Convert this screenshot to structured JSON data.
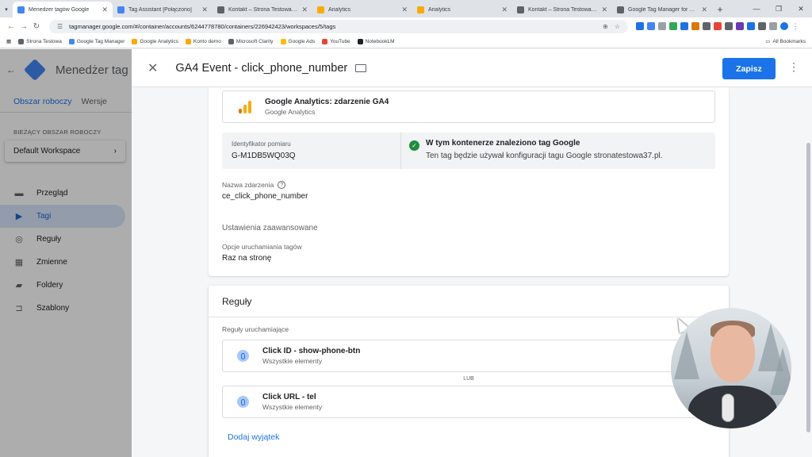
{
  "browser": {
    "tabs": [
      {
        "title": "Menedżer tagów Google",
        "active": true,
        "favicon_color": "#4285f4"
      },
      {
        "title": "Tag Assistant [Połączono]",
        "active": false,
        "favicon_color": "#4285f4"
      },
      {
        "title": "Kontakt – Strona Testowa 37",
        "active": false,
        "favicon_color": "#5f6368"
      },
      {
        "title": "Analytics",
        "active": false,
        "favicon_color": "#f9ab00"
      },
      {
        "title": "Analytics",
        "active": false,
        "favicon_color": "#f9ab00"
      },
      {
        "title": "Kontakt – Strona Testowa 37",
        "active": false,
        "favicon_color": "#5f6368"
      },
      {
        "title": "Google Tag Manager for WordP",
        "active": false,
        "favicon_color": "#5f6368"
      }
    ],
    "url": "tagmanager.google.com/#/container/accounts/6244778780/containers/226942423/workspaces/5/tags",
    "bookmarks": [
      {
        "label": "Strona Testowa",
        "color": "#5f6368"
      },
      {
        "label": "Google Tag Manager",
        "color": "#4285f4"
      },
      {
        "label": "Google Analytics",
        "color": "#f9ab00"
      },
      {
        "label": "Konto demo",
        "color": "#f9ab00"
      },
      {
        "label": "Microsoft Clarity",
        "color": "#5f6368"
      },
      {
        "label": "Google Ads",
        "color": "#fbbc04"
      },
      {
        "label": "YouTube",
        "color": "#ea4335"
      },
      {
        "label": "NotebookLM",
        "color": "#202124"
      }
    ],
    "all_bookmarks": "All Bookmarks"
  },
  "gtm": {
    "app_name": "Menedżer tag",
    "tabs": [
      "Obszar roboczy",
      "Wersje"
    ],
    "workspace_label": "BIEŻĄCY OBSZAR ROBOCZY",
    "workspace_name": "Default Workspace",
    "nav": [
      {
        "label": "Przegląd",
        "icon": "overview-icon",
        "glyph": "▬",
        "active": false
      },
      {
        "label": "Tagi",
        "icon": "tag-icon",
        "glyph": "▶",
        "active": true
      },
      {
        "label": "Reguły",
        "icon": "trigger-icon",
        "glyph": "◎",
        "active": false
      },
      {
        "label": "Zmienne",
        "icon": "variables-icon",
        "glyph": "▦",
        "active": false
      },
      {
        "label": "Foldery",
        "icon": "folder-icon",
        "glyph": "▰",
        "active": false
      },
      {
        "label": "Szablony",
        "icon": "template-icon",
        "glyph": "⊐",
        "active": false
      }
    ]
  },
  "editor": {
    "title": "GA4 Event - click_phone_number",
    "save_label": "Zapisz",
    "tag_type": {
      "title": "Google Analytics: zdarzenie GA4",
      "subtitle": "Google Analytics"
    },
    "measurement": {
      "label": "Identyfikator pomiaru",
      "value": "G-M1DB5WQ03Q",
      "status_title": "W tym kontenerze znaleziono tag Google",
      "status_desc": "Ten tag będzie używał konfiguracji tagu Google stronatestowa37.pl."
    },
    "event_name_label": "Nazwa zdarzenia",
    "event_name_value": "ce_click_phone_number",
    "advanced_label": "Ustawienia zaawansowane",
    "firing_options_label": "Opcje uruchamiania tagów",
    "firing_options_value": "Raz na stronę"
  },
  "triggers": {
    "title": "Reguły",
    "subtitle": "Reguły uruchamiające",
    "items": [
      {
        "title": "Click ID - show-phone-btn",
        "subtitle": "Wszystkie elementy"
      },
      {
        "title": "Click URL - tel",
        "subtitle": "Wszystkie elementy"
      }
    ],
    "or_label": "LUB",
    "add_exception": "Dodaj wyjątek"
  },
  "colors": {
    "accent": "#1a73e8",
    "success": "#1e8e3e",
    "ga_orange": "#f9ab00"
  }
}
